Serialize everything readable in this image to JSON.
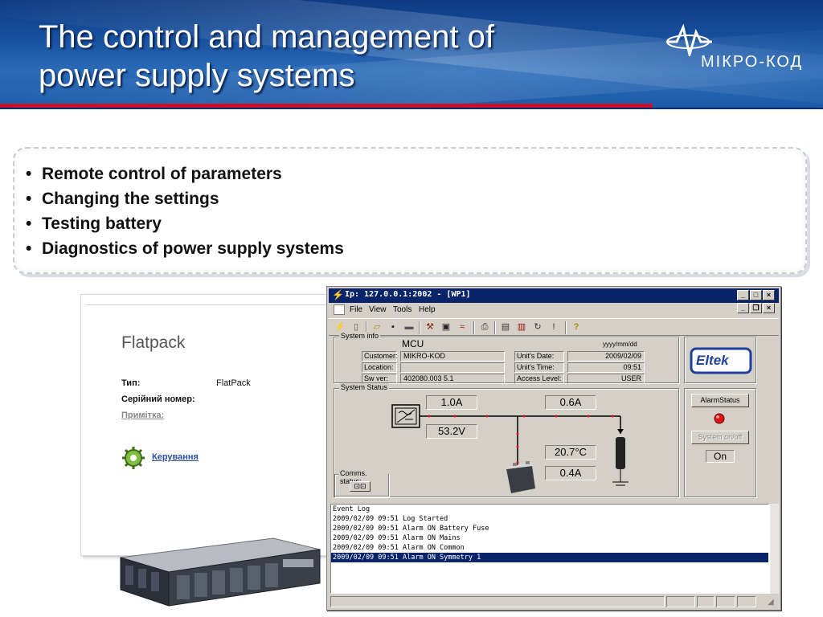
{
  "slide": {
    "title_line1": "The control and management of",
    "title_line2": "power supply  systems",
    "logo_text": "МІКРО-КОД",
    "bullets": [
      "Remote control of parameters",
      "Changing the settings",
      "Testing battery",
      "Diagnostics of power supply systems"
    ]
  },
  "flatpack": {
    "title": "Flatpack",
    "type_label": "Тип:",
    "type_value": "FlatPack",
    "serial_label": "Серійний номер:",
    "note_label": "Примітка:",
    "control_link": "Керування"
  },
  "app": {
    "window_title": "Ip: 127.0.0.1:2002 - [WP1]",
    "menu": [
      "File",
      "View",
      "Tools",
      "Help"
    ],
    "system_info": {
      "group_label": "System info",
      "mcu": "MCU",
      "date_format": "yyyy/mm/dd",
      "customer_label": "Customer:",
      "customer_value": "MIKRO-KOD",
      "location_label": "Location:",
      "location_value": "",
      "swver_label": "Sw ver:",
      "swver_value": "402080.003 5.1",
      "units_date_label": "Unit's Date:",
      "units_date_value": "2009/02/09",
      "units_time_label": "Unit's Time:",
      "units_time_value": "09:51",
      "access_label": "Access Level:",
      "access_value": "USER"
    },
    "system_status": {
      "group_label": "System Status",
      "rectifier_current": "1.0A",
      "voltage": "53.2V",
      "load_current": "0.6A",
      "battery_temp": "20.7°C",
      "battery_current": "0.4A"
    },
    "comms": {
      "label": "Comms. status:"
    },
    "brand": "Eltek",
    "alarm_status_button": "AlarmStatus",
    "system_onoff_button": "System on/off",
    "system_state": "On",
    "event_log": [
      "Event Log",
      "2009/02/09 09:51 Log Started",
      "2009/02/09 09:51 Alarm ON Battery Fuse",
      "2009/02/09 09:51 Alarm ON Mains",
      "2009/02/09 09:51 Alarm ON Common",
      "2009/02/09 09:51 Alarm ON Symmetry 1"
    ]
  },
  "colors": {
    "header_blue": "#17509e",
    "accent_red": "#c8102e",
    "titlebar_blue": "#0a246a",
    "eltek_blue": "#1f3f9c",
    "alarm_red": "#e01010"
  }
}
